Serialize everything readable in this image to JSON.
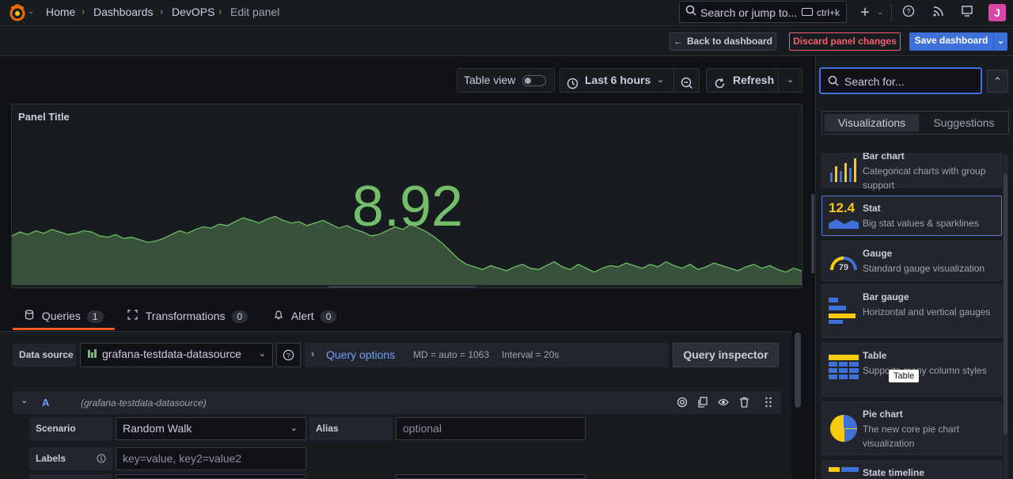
{
  "topbar": {
    "breadcrumbs": [
      "Home",
      "Dashboards",
      "DevOPS",
      "Edit panel"
    ],
    "search_placeholder": "Search or jump to...",
    "search_shortcut": "ctrl+k",
    "plus_label": "+",
    "avatar_initials": "J"
  },
  "actionbar": {
    "back_label": "Back to dashboard",
    "discard_label": "Discard panel changes",
    "save_label": "Save dashboard"
  },
  "toolbar": {
    "table_view_label": "Table view",
    "time_range": "Last 6 hours",
    "refresh_label": "Refresh"
  },
  "panel": {
    "title": "Panel Title",
    "stat_value": "8.92",
    "sparkline": [
      3.8,
      4.1,
      3.9,
      4.2,
      4.0,
      4.3,
      4.1,
      3.9,
      4.0,
      4.2,
      4.1,
      3.8,
      3.7,
      3.9,
      3.6,
      3.7,
      3.5,
      3.3,
      3.4,
      3.6,
      3.9,
      4.2,
      4.0,
      4.3,
      4.5,
      4.4,
      4.7,
      4.6,
      4.9,
      5.2,
      5.0,
      4.8,
      5.1,
      5.3,
      5.0,
      4.8,
      4.9,
      4.6,
      4.8,
      5.0,
      4.7,
      4.4,
      4.6,
      4.3,
      4.1,
      3.8,
      3.9,
      4.2,
      4.5,
      4.3,
      4.7,
      4.4,
      4.1,
      3.7,
      3.2,
      2.6,
      2.0,
      1.6,
      1.4,
      1.2,
      1.5,
      1.3,
      1.1,
      1.4,
      1.6,
      1.3,
      1.2,
      1.5,
      1.8,
      1.4,
      1.2,
      1.6,
      1.3,
      1.0,
      1.3,
      1.5,
      1.4,
      1.7,
      1.5,
      1.3,
      1.6,
      1.4,
      1.8,
      1.5,
      1.3,
      1.6,
      1.2,
      1.4,
      1.7,
      1.5,
      1.3,
      1.1,
      1.4,
      1.6,
      1.3,
      1.5,
      1.2,
      1.0,
      1.3,
      1.1
    ],
    "colors": {
      "value": "#73bf69",
      "area": "#37513a",
      "line": "#6cbf65"
    }
  },
  "tabs": [
    {
      "label": "Queries",
      "count": "1"
    },
    {
      "label": "Transformations",
      "count": "0"
    },
    {
      "label": "Alert",
      "count": "0"
    }
  ],
  "query": {
    "datasource_label": "Data source",
    "datasource_name": "grafana-testdata-datasource",
    "query_options_label": "Query options",
    "md_info": "MD = auto = 1063",
    "interval_info": "Interval = 20s",
    "inspector_label": "Query inspector",
    "ref_id": "A",
    "ref_datasource": "(grafana-testdata-datasource)",
    "scenario_label": "Scenario",
    "scenario_value": "Random Walk",
    "alias_label": "Alias",
    "alias_placeholder": "optional",
    "labels_label": "Labels",
    "labels_placeholder": "key=value, key2=value2"
  },
  "sidebar": {
    "search_placeholder": "Search for...",
    "tab_visualizations": "Visualizations",
    "tab_suggestions": "Suggestions",
    "tooltip": "Table",
    "items": [
      {
        "name": "Bar chart",
        "desc": "Categorical charts with group support"
      },
      {
        "name": "Stat",
        "desc": "Big stat values & sparklines",
        "icon_text": "12.4"
      },
      {
        "name": "Gauge",
        "desc": "Standard gauge visualization",
        "icon_text": "79"
      },
      {
        "name": "Bar gauge",
        "desc": "Horizontal and vertical gauges"
      },
      {
        "name": "Table",
        "desc": "Supports many column styles"
      },
      {
        "name": "Pie chart",
        "desc": "The new core pie chart visualization"
      },
      {
        "name": "State timeline",
        "desc": ""
      }
    ]
  },
  "accent_colors": {
    "primary": "#3d71d9",
    "danger": "#f55f71",
    "orange": "#ff5722"
  }
}
